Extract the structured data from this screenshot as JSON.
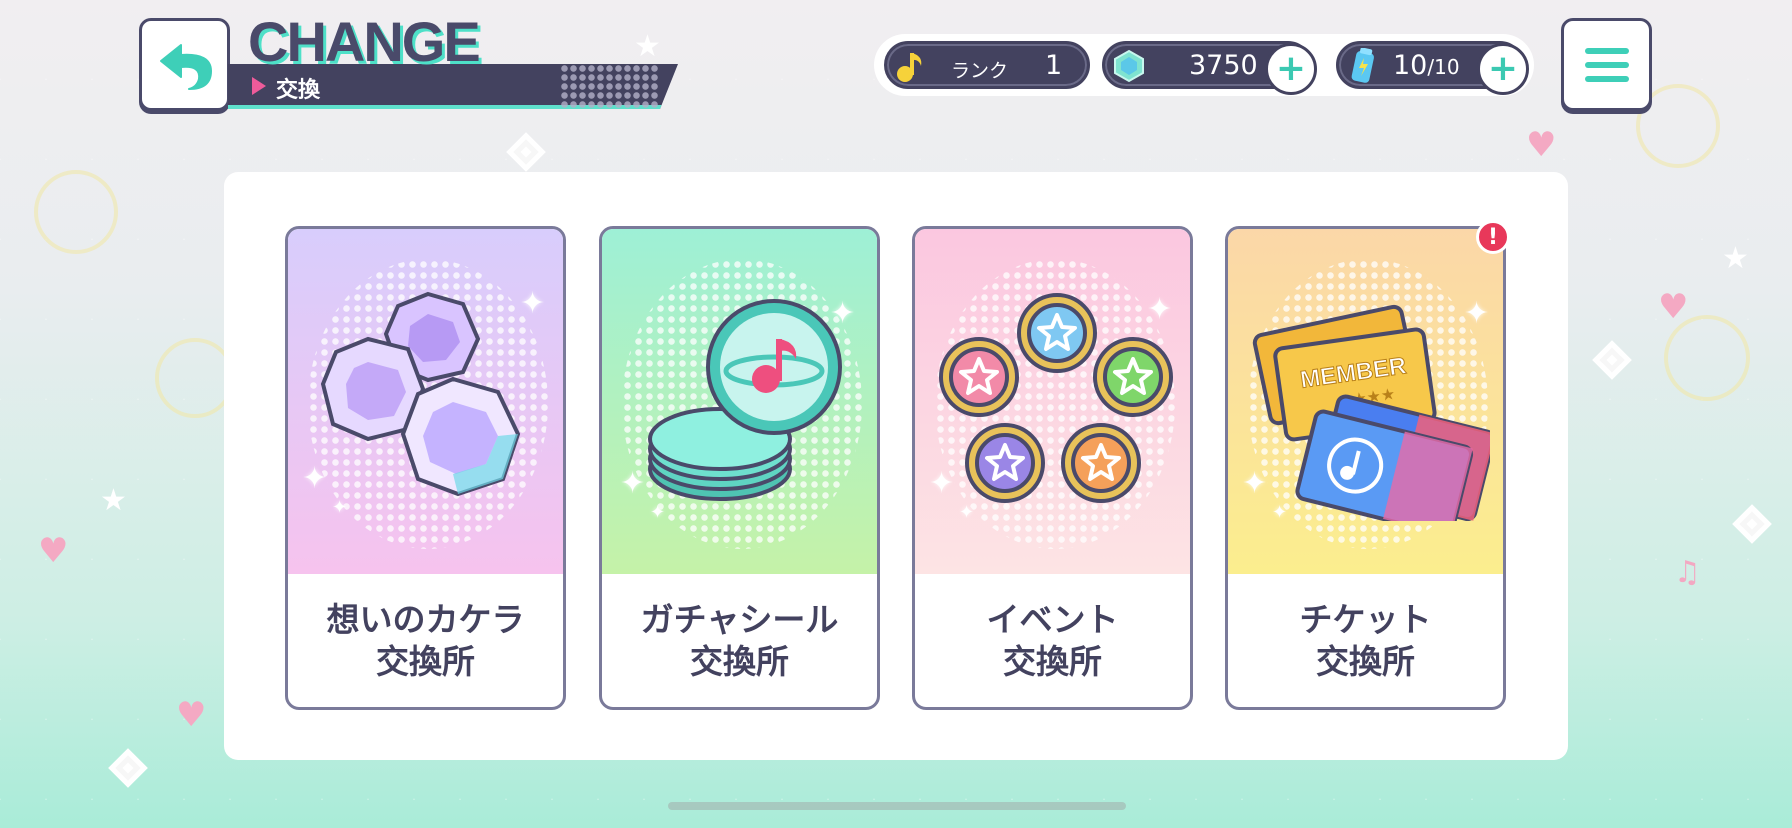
{
  "header": {
    "title": "CHANGE",
    "subtitle": "交換"
  },
  "currency": {
    "rank_label": "ランク",
    "rank_value": "1",
    "crystal_value": "3750",
    "energy_value": "10",
    "energy_max": "/10"
  },
  "cards": [
    {
      "line1": "想いのカケラ",
      "line2": "交換所",
      "bg_top": "#d8cdfc",
      "bg_bottom": "#f6c3ee"
    },
    {
      "line1": "ガチャシール",
      "line2": "交換所",
      "bg_top": "#9ef0d6",
      "bg_bottom": "#c5f2a8"
    },
    {
      "line1": "イベント",
      "line2": "交換所",
      "bg_top": "#fbc7e0",
      "bg_bottom": "#fde4e4"
    },
    {
      "line1": "チケット",
      "line2": "交換所",
      "bg_top": "#fbd7a8",
      "bg_bottom": "#fbee8e"
    }
  ],
  "ticket_card": {
    "member_text": "MEMBER",
    "alert_mark": "!"
  },
  "colors": {
    "accent_teal": "#3ecfb8",
    "dark_navy": "#43425f",
    "alert_red": "#e8385a"
  },
  "icons": {
    "back": "back-arrow-icon",
    "menu": "hamburger-menu-icon",
    "rank": "music-note-icon",
    "crystal": "crystal-gem-icon",
    "energy": "energy-bottle-icon"
  }
}
